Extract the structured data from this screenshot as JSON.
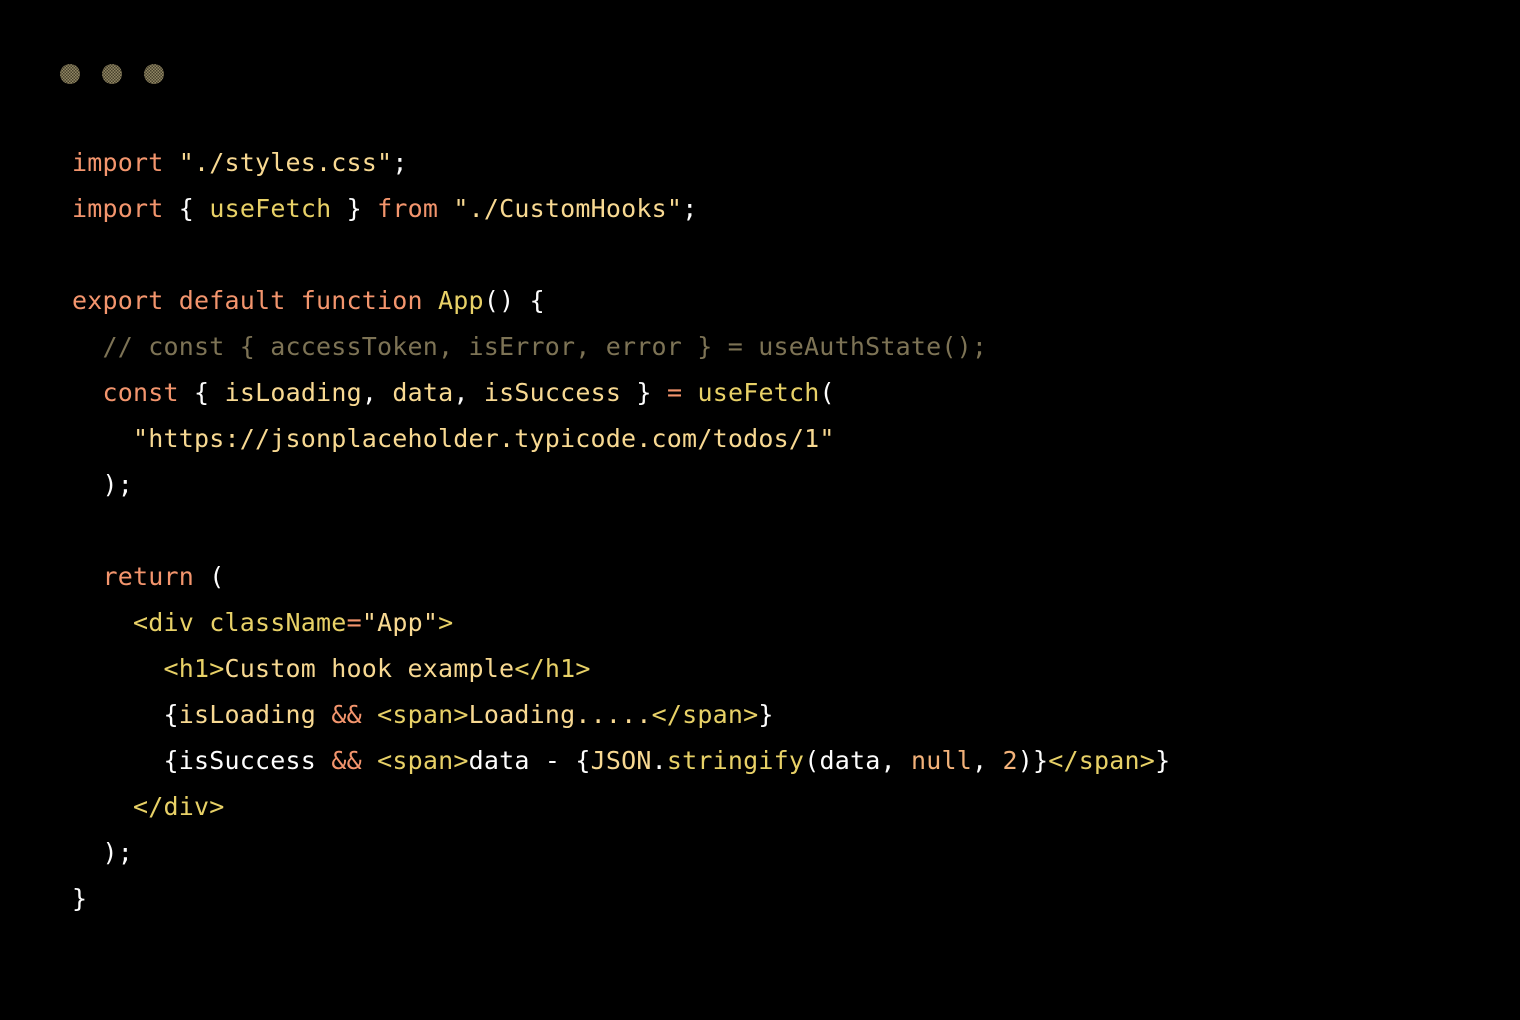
{
  "window": {
    "background_color": "#000000",
    "dots": [
      {
        "name": "close-dot",
        "color": "#7d7355"
      },
      {
        "name": "minimize-dot",
        "color": "#7d7355"
      },
      {
        "name": "maximize-dot",
        "color": "#7d7355"
      }
    ]
  },
  "theme": {
    "keyword": "#f3956d",
    "string": "#f8d992",
    "tag": "#e8d167",
    "punctuation": "#fdfdfd",
    "number": "#f3b27a",
    "comment": "#7d7355",
    "background": "#000000"
  },
  "code": {
    "language": "jsx",
    "full_text": "import \"./styles.css\";\nimport { useFetch } from \"./CustomHooks\";\n\nexport default function App() {\n  // const { accessToken, isError, error } = useAuthState();\n  const { isLoading, data, isSuccess } = useFetch(\n    \"https://jsonplaceholder.typicode.com/todos/1\"\n  );\n\n  return (\n    <div className=\"App\">\n      <h1>Custom hook example</h1>\n      {isLoading && <span>Loading.....</span>}\n      {isSuccess && <span>data - {JSON.stringify(data, null, 2)}</span>}\n    </div>\n  );\n}",
    "lines": [
      {
        "n": 1,
        "tokens": [
          {
            "t": "import",
            "c": "kw"
          },
          {
            "t": " ",
            "c": "pun"
          },
          {
            "t": "\"./styles.css\"",
            "c": "str"
          },
          {
            "t": ";",
            "c": "pun"
          }
        ]
      },
      {
        "n": 2,
        "tokens": [
          {
            "t": "import",
            "c": "kw"
          },
          {
            "t": " ",
            "c": "pun"
          },
          {
            "t": "{",
            "c": "pun"
          },
          {
            "t": " ",
            "c": "pun"
          },
          {
            "t": "useFetch",
            "c": "tag"
          },
          {
            "t": " ",
            "c": "pun"
          },
          {
            "t": "}",
            "c": "pun"
          },
          {
            "t": " ",
            "c": "pun"
          },
          {
            "t": "from",
            "c": "kw"
          },
          {
            "t": " ",
            "c": "pun"
          },
          {
            "t": "\"./CustomHooks\"",
            "c": "str"
          },
          {
            "t": ";",
            "c": "pun"
          }
        ]
      },
      {
        "n": 3,
        "tokens": []
      },
      {
        "n": 4,
        "tokens": [
          {
            "t": "export default function",
            "c": "kw"
          },
          {
            "t": " ",
            "c": "pun"
          },
          {
            "t": "App",
            "c": "tag"
          },
          {
            "t": "() {",
            "c": "pun"
          }
        ]
      },
      {
        "n": 5,
        "tokens": [
          {
            "t": "  // const { accessToken, isError, error } = useAuthState();",
            "c": "cmt"
          }
        ]
      },
      {
        "n": 6,
        "tokens": [
          {
            "t": "  ",
            "c": "pun"
          },
          {
            "t": "const",
            "c": "kw"
          },
          {
            "t": " ",
            "c": "pun"
          },
          {
            "t": "{",
            "c": "pun"
          },
          {
            "t": " ",
            "c": "pun"
          },
          {
            "t": "isLoading",
            "c": "str"
          },
          {
            "t": ", ",
            "c": "pun"
          },
          {
            "t": "data",
            "c": "str"
          },
          {
            "t": ", ",
            "c": "pun"
          },
          {
            "t": "isSuccess",
            "c": "str"
          },
          {
            "t": " ",
            "c": "pun"
          },
          {
            "t": "}",
            "c": "pun"
          },
          {
            "t": " ",
            "c": "pun"
          },
          {
            "t": "=",
            "c": "kw"
          },
          {
            "t": " ",
            "c": "pun"
          },
          {
            "t": "useFetch",
            "c": "tag"
          },
          {
            "t": "(",
            "c": "pun"
          }
        ]
      },
      {
        "n": 7,
        "tokens": [
          {
            "t": "    ",
            "c": "pun"
          },
          {
            "t": "\"https://jsonplaceholder.typicode.com/todos/1\"",
            "c": "str"
          }
        ]
      },
      {
        "n": 8,
        "tokens": [
          {
            "t": "  );",
            "c": "pun"
          }
        ]
      },
      {
        "n": 9,
        "tokens": []
      },
      {
        "n": 10,
        "tokens": [
          {
            "t": "  ",
            "c": "pun"
          },
          {
            "t": "return",
            "c": "kw"
          },
          {
            "t": " ",
            "c": "pun"
          },
          {
            "t": "(",
            "c": "pun"
          }
        ]
      },
      {
        "n": 11,
        "tokens": [
          {
            "t": "    ",
            "c": "pun"
          },
          {
            "t": "<div",
            "c": "tag"
          },
          {
            "t": " ",
            "c": "pun"
          },
          {
            "t": "className",
            "c": "tag"
          },
          {
            "t": "=",
            "c": "kw"
          },
          {
            "t": "\"App\"",
            "c": "str"
          },
          {
            "t": ">",
            "c": "tag"
          }
        ]
      },
      {
        "n": 12,
        "tokens": [
          {
            "t": "      ",
            "c": "pun"
          },
          {
            "t": "<h1>",
            "c": "tag"
          },
          {
            "t": "Custom hook example",
            "c": "str"
          },
          {
            "t": "</h1>",
            "c": "tag"
          }
        ]
      },
      {
        "n": 13,
        "tokens": [
          {
            "t": "      ",
            "c": "pun"
          },
          {
            "t": "{",
            "c": "pun"
          },
          {
            "t": "isLoading",
            "c": "str"
          },
          {
            "t": " ",
            "c": "pun"
          },
          {
            "t": "&&",
            "c": "kw"
          },
          {
            "t": " ",
            "c": "pun"
          },
          {
            "t": "<span>",
            "c": "tag"
          },
          {
            "t": "Loading.....",
            "c": "str"
          },
          {
            "t": "</span>",
            "c": "tag"
          },
          {
            "t": "}",
            "c": "pun"
          }
        ]
      },
      {
        "n": 14,
        "tokens": [
          {
            "t": "      ",
            "c": "pun"
          },
          {
            "t": "{",
            "c": "pun"
          },
          {
            "t": "isSuccess",
            "c": "txt"
          },
          {
            "t": " ",
            "c": "pun"
          },
          {
            "t": "&&",
            "c": "kw"
          },
          {
            "t": " ",
            "c": "pun"
          },
          {
            "t": "<span>",
            "c": "tag"
          },
          {
            "t": "data - ",
            "c": "txt"
          },
          {
            "t": "{",
            "c": "pun"
          },
          {
            "t": "JSON",
            "c": "str"
          },
          {
            "t": ".",
            "c": "pun"
          },
          {
            "t": "stringify",
            "c": "tag"
          },
          {
            "t": "(",
            "c": "pun"
          },
          {
            "t": "data",
            "c": "txt"
          },
          {
            "t": ", ",
            "c": "pun"
          },
          {
            "t": "null",
            "c": "num"
          },
          {
            "t": ", ",
            "c": "pun"
          },
          {
            "t": "2",
            "c": "num"
          },
          {
            "t": ")}",
            "c": "pun"
          },
          {
            "t": "</span>",
            "c": "tag"
          },
          {
            "t": "}",
            "c": "pun"
          }
        ]
      },
      {
        "n": 15,
        "tokens": [
          {
            "t": "    ",
            "c": "pun"
          },
          {
            "t": "</div>",
            "c": "tag"
          }
        ]
      },
      {
        "n": 16,
        "tokens": [
          {
            "t": "  );",
            "c": "pun"
          }
        ]
      },
      {
        "n": 17,
        "tokens": [
          {
            "t": "}",
            "c": "pun"
          }
        ]
      }
    ]
  }
}
